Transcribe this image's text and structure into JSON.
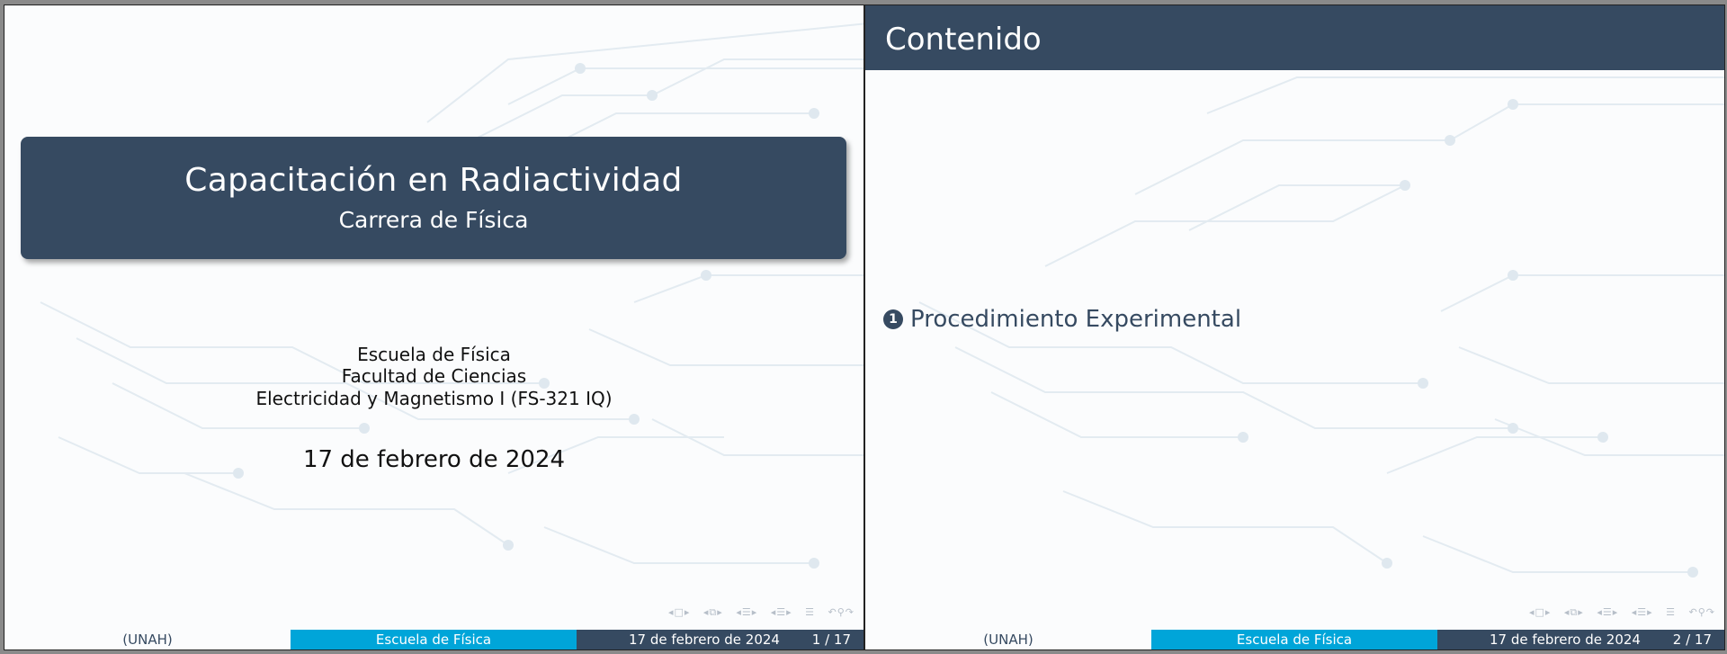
{
  "slides": [
    {
      "title": "Capacitación en Radiactividad",
      "subtitle": "Carrera de Física",
      "institute_lines": [
        "Escuela de Física",
        "Facultad de Ciencias",
        "Electricidad y Magnetismo I (FS-321 IQ)"
      ],
      "date": "17 de febrero de 2024",
      "footer": {
        "left": "(UNAH)",
        "center": "Escuela de Física",
        "date": "17 de febrero de 2024",
        "page": "1 / 17"
      }
    },
    {
      "frame_title": "Contenido",
      "toc": [
        {
          "number": "1",
          "label": "Procedimiento Experimental"
        }
      ],
      "footer": {
        "left": "(UNAH)",
        "center": "Escuela de Física",
        "date": "17 de febrero de 2024",
        "page": "2 / 17"
      }
    }
  ],
  "colors": {
    "primary": "#364a61",
    "accent": "#00a5d9",
    "background": "#fbfcfd"
  },
  "navigation_icons": [
    "frame-prev-icon",
    "frame-icon",
    "frame-next-icon",
    "subsection-icon",
    "section-icon",
    "doc-icon",
    "undo-icon",
    "search-icon",
    "redo-icon"
  ]
}
